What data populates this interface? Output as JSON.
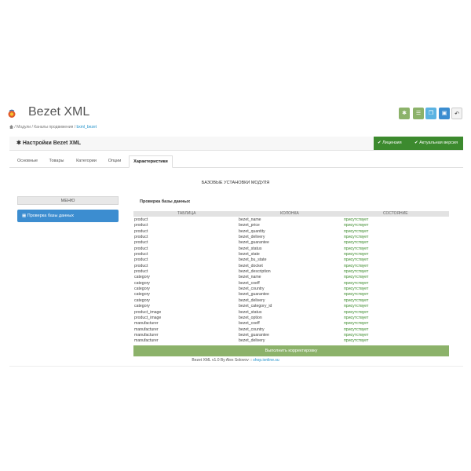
{
  "header": {
    "title": "Bezet XML",
    "toolbar": [
      {
        "name": "settings-button",
        "icon": "gear-icon",
        "glyph": "✱",
        "color": "#8cb26a"
      },
      {
        "name": "list-button",
        "icon": "list-icon",
        "glyph": "☰",
        "color": "#8cb26a"
      },
      {
        "name": "copy-button",
        "icon": "copy-icon",
        "glyph": "❐",
        "color": "#5bb3e2"
      },
      {
        "name": "save-button",
        "icon": "save-icon",
        "glyph": "▣",
        "color": "#3c8dd0"
      },
      {
        "name": "back-button",
        "icon": "undo-icon",
        "glyph": "↶",
        "color": "#f3f3f3"
      }
    ]
  },
  "breadcrumb": {
    "items": [
      "Модули",
      "Каналы продвижения"
    ],
    "current": "bxml_bezet",
    "separator": "/"
  },
  "panel": {
    "title": "Настройки Bezet XML",
    "license_label": "Лицензия",
    "version_label": "Актуальная версия"
  },
  "tabs": [
    "Основные",
    "Товары",
    "Категории",
    "Опции",
    "Характеристики"
  ],
  "active_tab": "Характеристики",
  "section_title": "БАЗОВЫЕ УСТАНОВКИ МОДУЛЯ",
  "menu": {
    "header": "МЕНЮ",
    "item": "Проверка базы данных"
  },
  "db_check": {
    "title": "Проверка базы данных",
    "columns": [
      "ТАБЛИЦА",
      "КОЛОНКА",
      "СОСТОЯНИЕ"
    ],
    "rows": [
      [
        "product",
        "bezet_name",
        "присутствует"
      ],
      [
        "product",
        "bezet_price",
        "присутствует"
      ],
      [
        "product",
        "bezet_quantity",
        "присутствует"
      ],
      [
        "product",
        "bezet_delivery",
        "присутствует"
      ],
      [
        "product",
        "bezet_guarantee",
        "присутствует"
      ],
      [
        "product",
        "bezet_status",
        "присутствует"
      ],
      [
        "product",
        "bezet_state",
        "присутствует"
      ],
      [
        "product",
        "bezet_bu_state",
        "присутствует"
      ],
      [
        "product",
        "bezet_docket",
        "присутствует"
      ],
      [
        "product",
        "bezet_description",
        "присутствует"
      ],
      [
        "category",
        "bezet_name",
        "присутствует"
      ],
      [
        "category",
        "bezet_coeff",
        "присутствует"
      ],
      [
        "category",
        "bezet_country",
        "присутствует"
      ],
      [
        "category",
        "bezet_guarantee",
        "присутствует"
      ],
      [
        "category",
        "bezet_delivery",
        "присутствует"
      ],
      [
        "category",
        "bezet_category_id",
        "присутствует"
      ],
      [
        "product_image",
        "bezet_status",
        "присутствует"
      ],
      [
        "product_image",
        "bezet_option",
        "присутствует"
      ],
      [
        "manufacturer",
        "bezet_coeff",
        "присутствует"
      ],
      [
        "manufacturer",
        "bezet_country",
        "присутствует"
      ],
      [
        "manufacturer",
        "bezet_guarantee",
        "присутствует"
      ],
      [
        "manufacturer",
        "bezet_delivery",
        "присутствует"
      ]
    ],
    "run_button": "Выполнить корректировку"
  },
  "footer": {
    "text": "Bezet XML v1.0 By Alex Solovov ::",
    "link": "shop.ionline.su"
  },
  "colors": {
    "accent_green": "#3c8a2e",
    "present_green": "#3a8a2a",
    "menu_blue": "#3c8dd0",
    "run_button": "#8cb26a"
  }
}
